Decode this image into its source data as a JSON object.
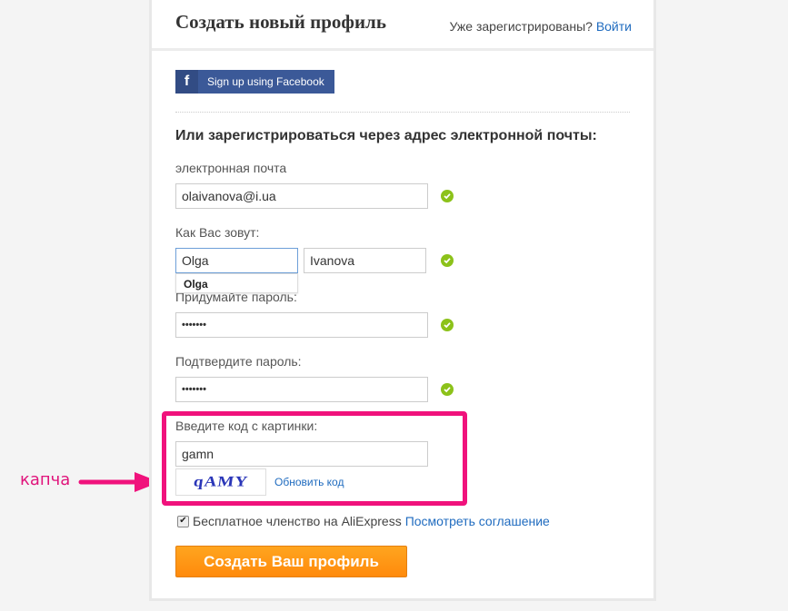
{
  "header": {
    "title": "Создать новый профиль",
    "already_registered": "Уже зарегистрированы?",
    "login_link": "Войти"
  },
  "facebook": {
    "icon": "facebook-f-icon",
    "label": "Sign up using Facebook",
    "color": "#3b5998"
  },
  "form": {
    "subheading": "Или зарегистрироваться через адрес электронной почты:",
    "email": {
      "label": "электронная почта",
      "value": "olaivanova@i.ua",
      "valid": true
    },
    "name": {
      "label": "Как Вас зовут:",
      "first_value": "Olga",
      "last_value": "Ivanova",
      "valid": true
    },
    "autocomplete_suggestion": "Olga",
    "password": {
      "label": "Придумайте пароль:",
      "value": "•••••••",
      "valid": true
    },
    "confirm_password": {
      "label": "Подтвердите пароль:",
      "value": "•••••••",
      "valid": true
    },
    "captcha": {
      "label": "Введите код с картинки:",
      "value": "gamn",
      "image_text": "qAMY",
      "refresh_link": "Обновить код"
    },
    "terms": {
      "checked": true,
      "text": "Бесплатное членство на AliExpress",
      "link": "Посмотреть соглашение"
    },
    "submit_label": "Создать Ваш профиль"
  },
  "annotation": {
    "label": "капча",
    "color": "#f0127c"
  },
  "colors": {
    "link": "#1f6bbf",
    "valid": "#8cc21a",
    "submit": "#ff9a15"
  }
}
